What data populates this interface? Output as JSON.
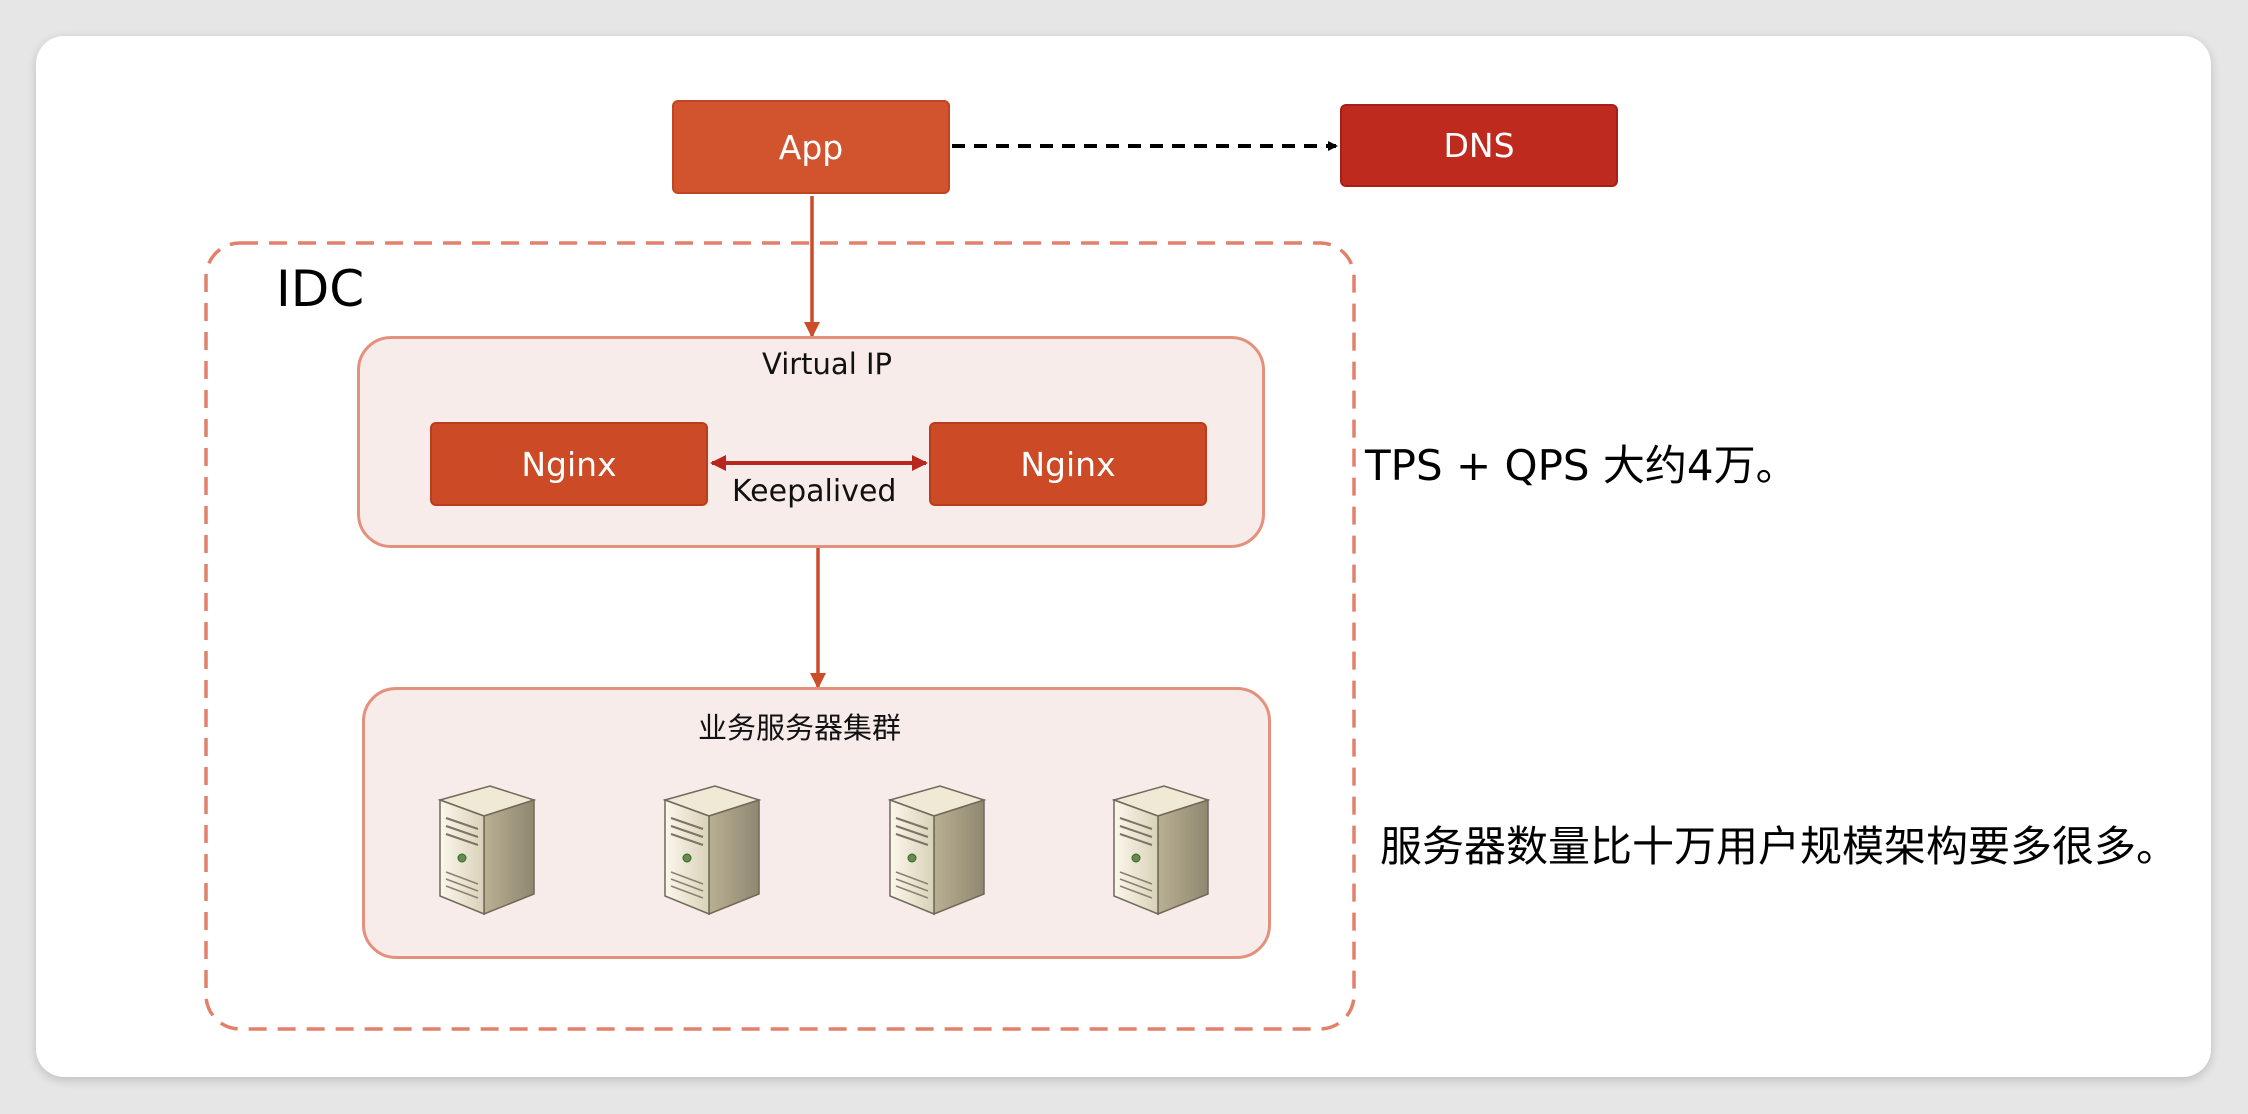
{
  "nodes": {
    "app": "App",
    "dns": "DNS",
    "nginx_left": "Nginx",
    "nginx_right": "Nginx"
  },
  "labels": {
    "idc": "IDC",
    "virtual_ip": "Virtual IP",
    "keepalived": "Keepalived",
    "server_cluster": "业务服务器集群"
  },
  "notes": {
    "tps_qps": "TPS + QPS 大约4万。",
    "server_count": "服务器数量比十万用户规模架构要多很多。"
  },
  "servers": [
    {
      "icon": "server-icon"
    },
    {
      "icon": "server-icon"
    },
    {
      "icon": "server-icon"
    },
    {
      "icon": "server-icon"
    }
  ],
  "colors": {
    "app": "#d2542e",
    "dns": "#bf2a1f",
    "nginx": "#cd4a26",
    "group_fill": "#f8ecea",
    "group_border": "#e3907c",
    "idc_border": "#e3806a",
    "arrow": "#cc4d2a",
    "keepalived_arrow": "#b7271d"
  }
}
